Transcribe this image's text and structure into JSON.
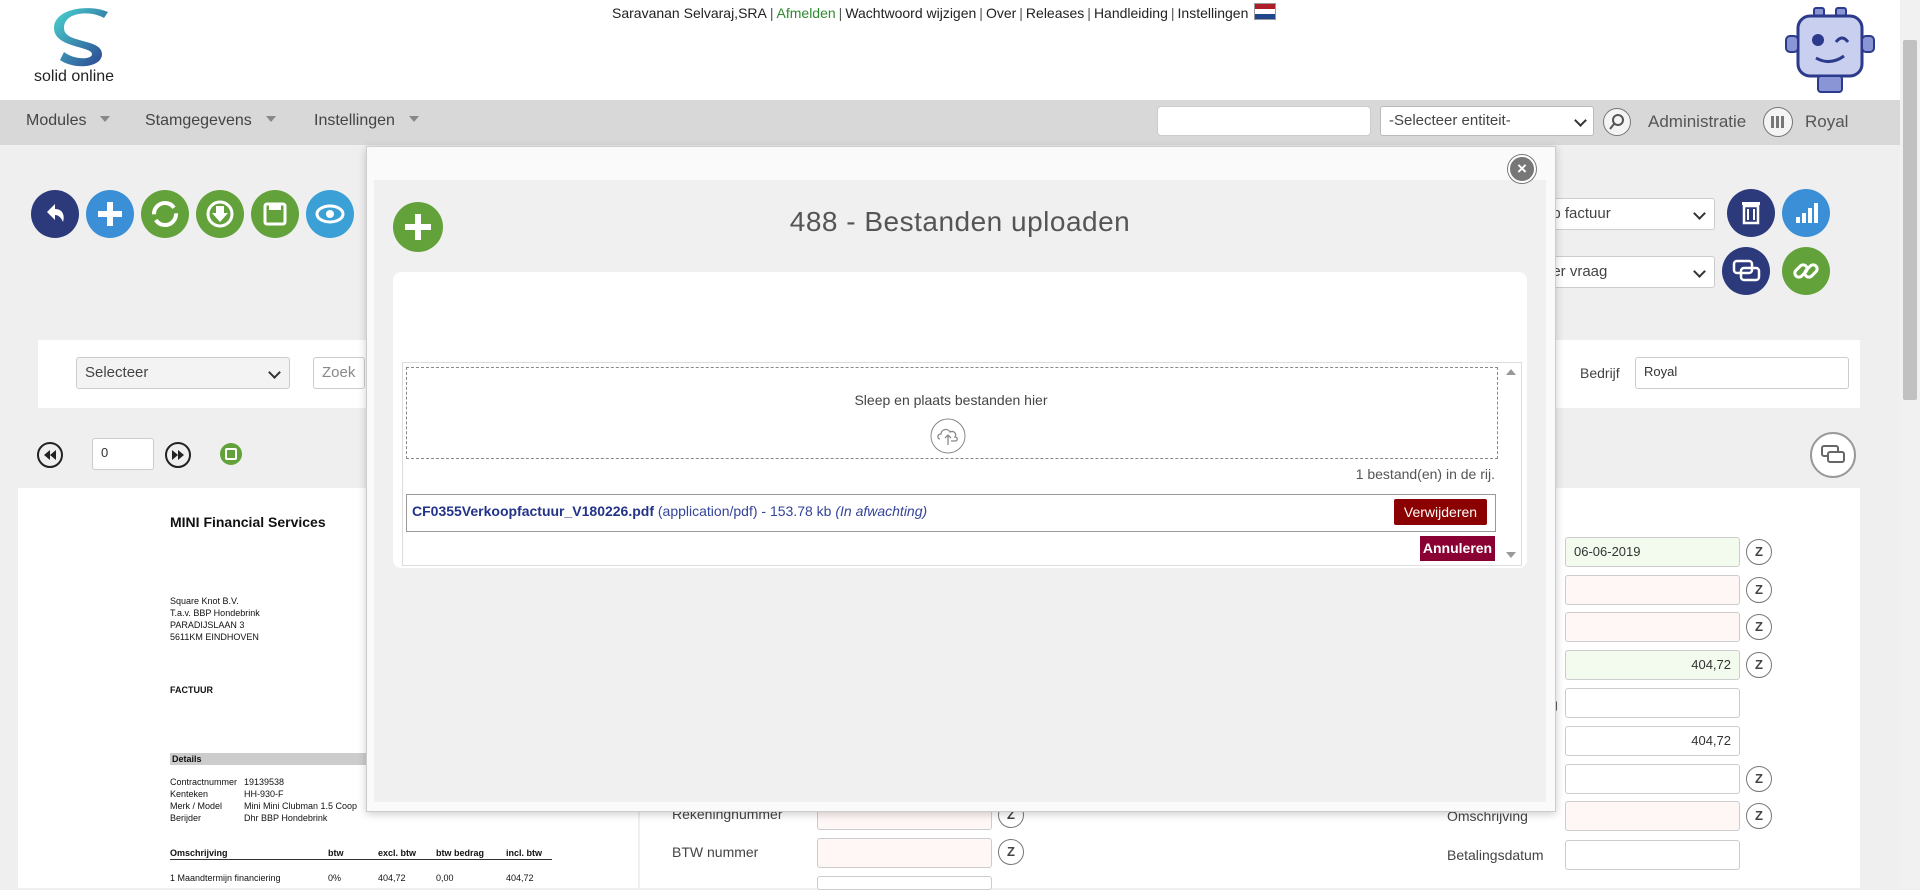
{
  "app": {
    "logo_text": "solid online",
    "top_links": {
      "user": "Saravanan Selvaraj,SRA",
      "logout": "Afmelden",
      "change_password": "Wachtwoord wijzigen",
      "about": "Over",
      "releases": "Releases",
      "manual": "Handleiding",
      "settings": "Instellingen"
    },
    "nav": {
      "modules": "Modules",
      "master_data": "Stamgegevens",
      "settings": "Instellingen",
      "search_value": "",
      "entity_select": "-Selecteer entiteit-",
      "administration": "Administratie",
      "company": "Royal"
    }
  },
  "toolbar": {
    "invoice_type_select": "op factuur",
    "question_select": "eer vraag"
  },
  "filter": {
    "select": "Selecteer",
    "search_placeholder": "Zoek",
    "company_label": "Bedrijf",
    "company_value": "Royal"
  },
  "pager": {
    "page_value": "0"
  },
  "document_preview": {
    "company": "MINI Financial Services",
    "address": [
      "Square Knot B.V.",
      "T.a.v. BBP Hondebrink",
      "PARADIJSLAAN 3",
      "5611KM EINDHOVEN"
    ],
    "doc_type": "FACTUUR",
    "details_header": "Details",
    "details": [
      {
        "label": "Contractnummer",
        "value": "19139538"
      },
      {
        "label": "Kenteken",
        "value": "HH-930-F"
      },
      {
        "label": "Merk / Model",
        "value": "Mini Mini Clubman 1.5 Coop"
      },
      {
        "label": "Berijder",
        "value": "Dhr BBP Hondebrink"
      }
    ],
    "table_headers": [
      "Omschrijving",
      "btw",
      "excl. btw",
      "btw bedrag",
      "incl. btw"
    ],
    "table_rows": [
      [
        "1    Maandtermijn financiering",
        "0%",
        "404,72",
        "0,00",
        "404,72"
      ]
    ]
  },
  "form": {
    "left_labels": [
      "Rekeningnummer",
      "BTW nummer"
    ],
    "right_labels": [
      "Omschrijving",
      "Betalingsdatum"
    ],
    "date_value": "06-06-2019",
    "amount_value": "404,72",
    "amount_value_2": "404,72",
    "cut_label_fragment": "g"
  },
  "modal": {
    "title": "488 - Bestanden uploaden",
    "drop_text": "Sleep en plaats bestanden hier",
    "queue_count": "1 bestand(en) in de rij.",
    "file_name": "CF0355Verkoopfactuur_V180226.pdf",
    "file_meta": "(application/pdf) - 153.78 kb",
    "file_status": "(In afwachting)",
    "remove_label": "Verwijderen",
    "cancel_label": "Annuleren",
    "close_symbol": "×"
  }
}
